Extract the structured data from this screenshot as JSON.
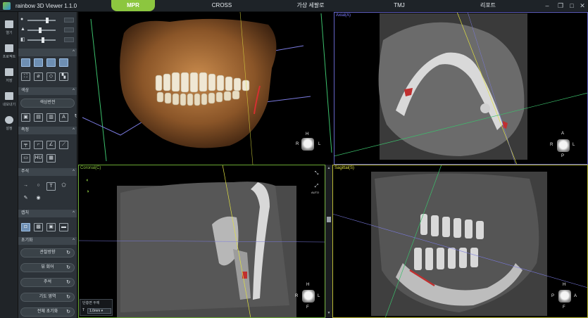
{
  "app": {
    "title": "rainbow 3D Viewer 1.1.0",
    "brand_color": "#8cc63f"
  },
  "tabs": [
    {
      "label": "MPR",
      "active": true
    },
    {
      "label": "CROSS",
      "active": false
    },
    {
      "label": "가상 세팔로",
      "active": false
    },
    {
      "label": "TMJ",
      "active": false
    },
    {
      "label": "리포트",
      "active": false
    }
  ],
  "window_controls": [
    "minimize-icon",
    "restore-icon",
    "maximize-icon",
    "close-icon"
  ],
  "left_toolbar": [
    {
      "icon": "folder-icon",
      "label": "열기"
    },
    {
      "icon": "project-folder-icon",
      "label": "프로젝트"
    },
    {
      "icon": "download-icon",
      "label": "저장"
    },
    {
      "icon": "export-icon",
      "label": "내보내기"
    },
    {
      "icon": "gear-icon",
      "label": "설정"
    }
  ],
  "side_panel": {
    "sections": {
      "color": "색상",
      "measure": "측정",
      "annotation": "주석",
      "capture": "캡처",
      "reset": "초기화"
    },
    "color_toggle_label": "색상반전",
    "reset_buttons": [
      "관찰방향",
      "뷰 회어",
      "주석",
      "기도 영역",
      "전체 초기화"
    ]
  },
  "viewports": {
    "axial": {
      "label": "Axial(A)",
      "color": "#7c7cff"
    },
    "coronal": {
      "label": "Coronal(C)",
      "color": "#8cc63f"
    },
    "sagittal": {
      "label": "Sagittal(S)",
      "color": "#e0e040"
    }
  },
  "orientation": {
    "vr": [
      "H",
      "R",
      "L"
    ],
    "axial": [
      "A",
      "R",
      "L",
      "P"
    ],
    "coronal": [
      "H",
      "R",
      "L",
      "F"
    ],
    "sagittal": [
      "H",
      "P",
      "A",
      "F"
    ]
  },
  "coronal_tools": {
    "auto_label": "AUTO"
  },
  "slab": {
    "title": "단층면 두께",
    "t_label": "T",
    "value": "1.0mm"
  }
}
